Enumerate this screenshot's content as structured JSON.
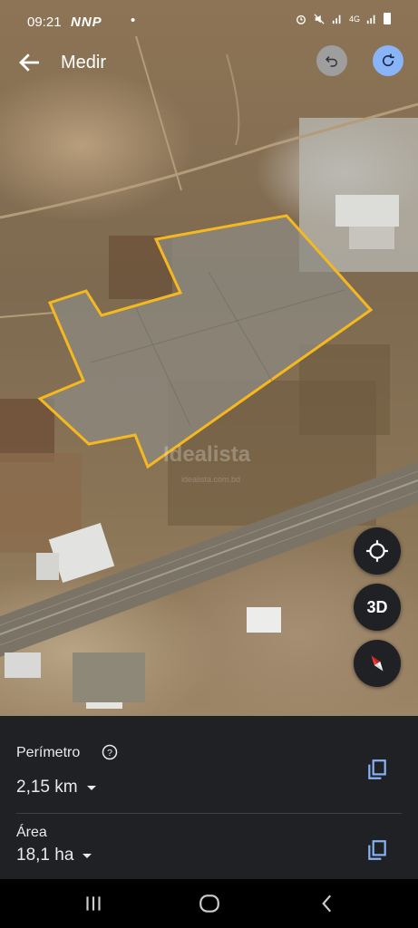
{
  "status_bar": {
    "time": "09:21",
    "carriers": "NNP",
    "dot": "•",
    "network": "4G"
  },
  "toolbar": {
    "title": "Medir",
    "back_icon": "arrow-back-icon",
    "undo_icon": "undo-icon",
    "redo_icon": "redo-icon"
  },
  "map": {
    "watermark": "Idealista",
    "watermark_sub": "idealista.com.bd",
    "fab_3d_label": "3D",
    "polygon_color": "#f5b820"
  },
  "measurement": {
    "perimeter_label": "Perímetro",
    "perimeter_value": "2,15 km",
    "area_label": "Área",
    "area_value": "18,1 ha"
  },
  "colors": {
    "accent_blue": "#8ab4f8",
    "sheet_bg": "#202124",
    "compass_red": "#ea4335"
  }
}
